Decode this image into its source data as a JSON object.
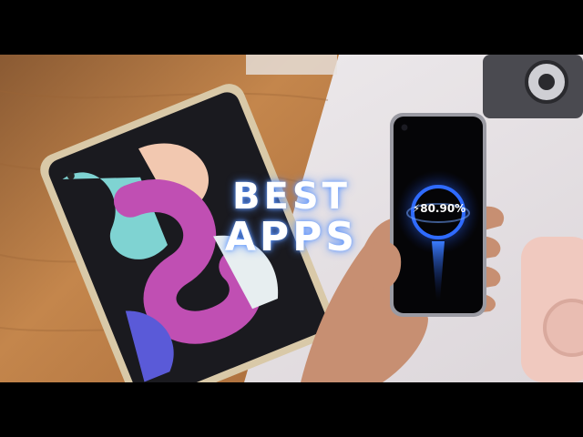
{
  "headline": {
    "line1": "BEST",
    "line2": "APPS"
  },
  "charging": {
    "bolt": "⚡",
    "percent": "80.90%"
  },
  "colors": {
    "letterbox": "#000000",
    "table_wood": "#b97a45",
    "backdrop": "#e9e5e7",
    "glow": "#2f6bff"
  }
}
